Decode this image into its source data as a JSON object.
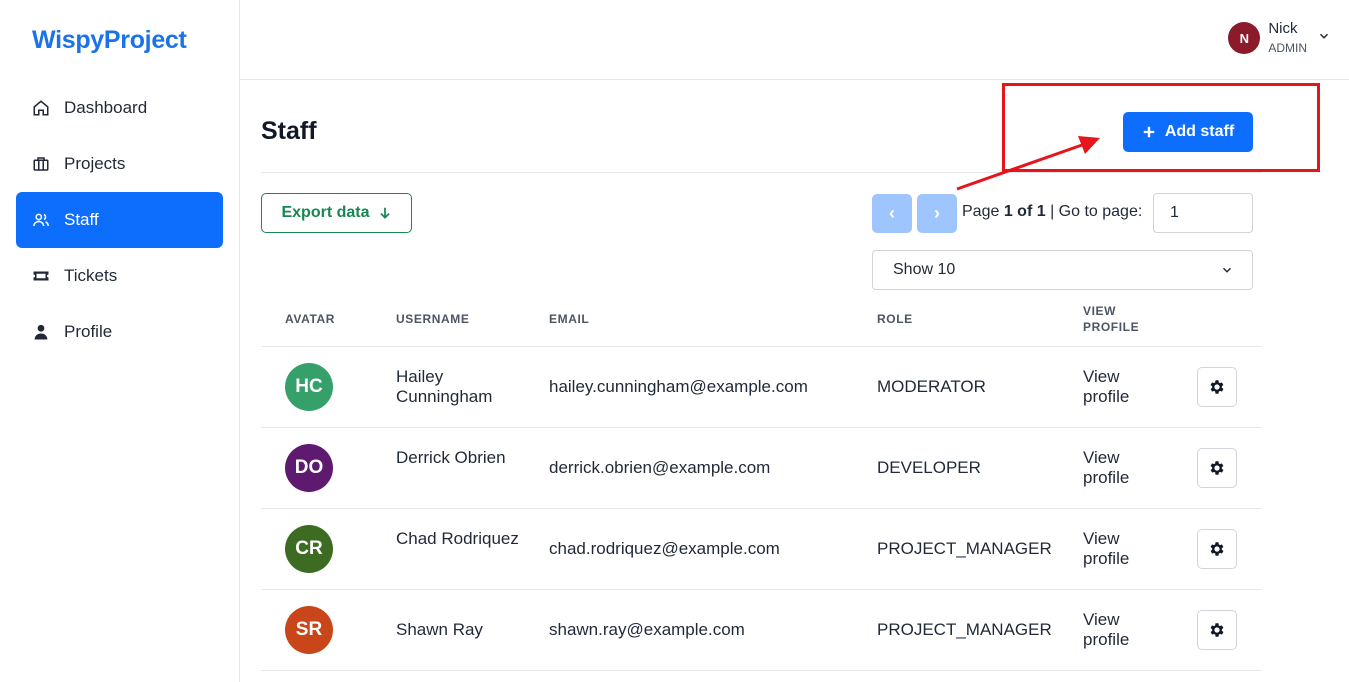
{
  "brand": "WispyProject",
  "sidebar": {
    "items": [
      {
        "label": "Dashboard",
        "icon": "home-icon"
      },
      {
        "label": "Projects",
        "icon": "briefcase-icon"
      },
      {
        "label": "Staff",
        "icon": "users-icon",
        "active": true
      },
      {
        "label": "Tickets",
        "icon": "ticket-icon"
      },
      {
        "label": "Profile",
        "icon": "user-icon"
      }
    ]
  },
  "header": {
    "user": {
      "initial": "N",
      "name": "Nick",
      "role": "ADMIN",
      "avatar_color": "#8b1a2b"
    }
  },
  "main": {
    "title": "Staff",
    "add_button": "Add staff",
    "export_button": "Export data",
    "pagination": {
      "prev": "‹",
      "next": "›",
      "page_label": "Page",
      "current": "1 of 1",
      "goto_label": "| Go to page:",
      "goto_value": "1"
    },
    "show_select": "Show 10",
    "columns": [
      "AVATAR",
      "USERNAME",
      "EMAIL",
      "ROLE",
      "VIEW PROFILE"
    ],
    "rows": [
      {
        "initials": "HC",
        "color": "#36a06b",
        "username": "Hailey Cunningham",
        "email": "hailey.cunningham@example.com",
        "role": "MODERATOR",
        "view": "View profile"
      },
      {
        "initials": "DO",
        "color": "#5e1a6e",
        "username": "Derrick Obrien",
        "email": "derrick.obrien@example.com",
        "role": "DEVELOPER",
        "view": "View profile"
      },
      {
        "initials": "CR",
        "color": "#3e6b22",
        "username": "Chad Rodriquez",
        "email": "chad.rodriquez@example.com",
        "role": "PROJECT_MANAGER",
        "view": "View profile"
      },
      {
        "initials": "SR",
        "color": "#c8461a",
        "username": "Shawn Ray",
        "email": "shawn.ray@example.com",
        "role": "PROJECT_MANAGER",
        "view": "View profile"
      }
    ]
  },
  "colors": {
    "primary": "#0d6efd",
    "success": "#198754",
    "annotation": "#e6141b",
    "pager_disabled": "#9ec5fe"
  }
}
